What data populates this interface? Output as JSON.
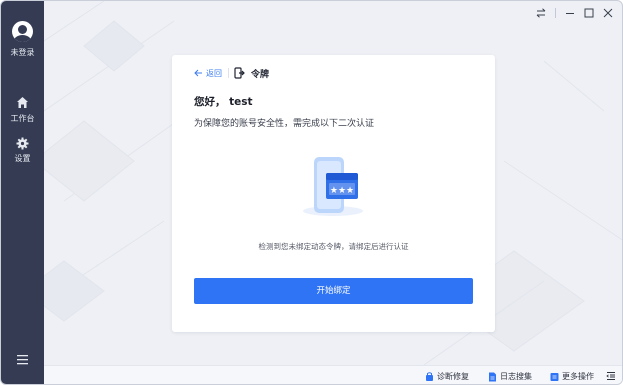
{
  "sidebar": {
    "user_label": "未登录",
    "items": [
      {
        "label": "工作台",
        "icon": "home-icon"
      },
      {
        "label": "设置",
        "icon": "gear-icon"
      }
    ],
    "menu_icon": "menu-icon"
  },
  "window_controls": {
    "icons": [
      "swap-icon",
      "minimize-icon",
      "maximize-icon",
      "close-icon"
    ]
  },
  "card": {
    "back_label": "返回",
    "title": "令牌",
    "greeting": "您好， test",
    "subtitle": "为保障您的账号安全性，需完成以下二次认证",
    "hint": "检测到您未绑定动态令牌，请绑定后进行认证",
    "button_label": "开始绑定"
  },
  "footer": {
    "items": [
      {
        "label": "诊断修复",
        "icon": "repair-icon"
      },
      {
        "label": "日志搜集",
        "icon": "log-icon"
      },
      {
        "label": "更多操作",
        "icon": "more-icon"
      }
    ],
    "collapse_icon": "collapse-icon"
  },
  "colors": {
    "sidebar_bg": "#343b52",
    "accent": "#2f74f4",
    "link": "#3d7cf0",
    "content_bg": "#eef0f5"
  }
}
